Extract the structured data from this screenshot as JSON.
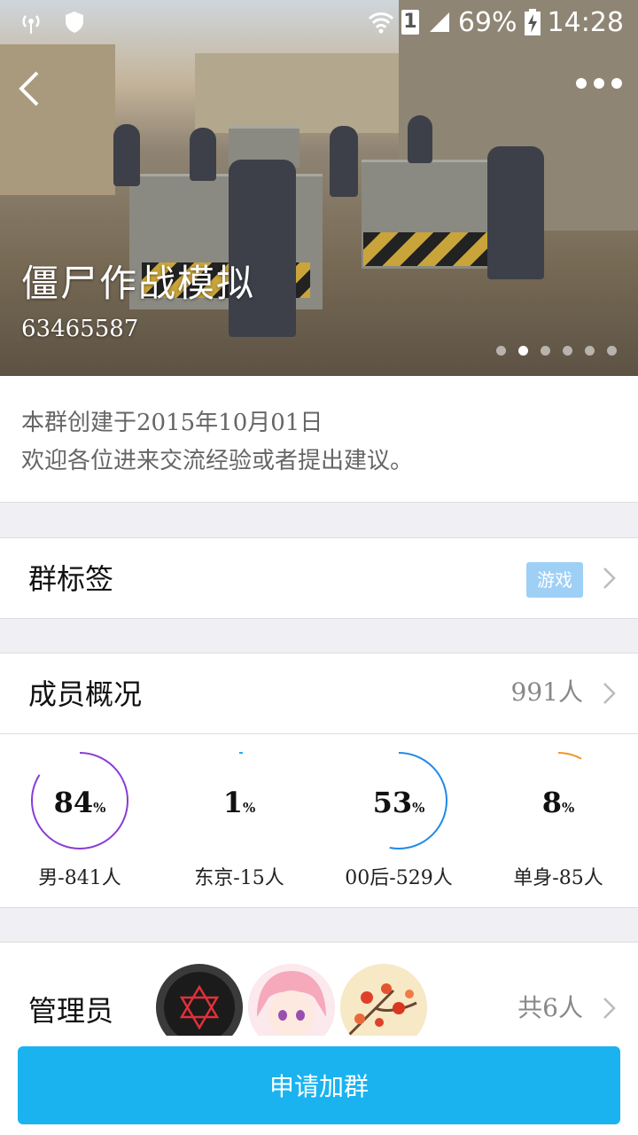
{
  "status_bar": {
    "battery": "69%",
    "time": "14:28",
    "sim": "1"
  },
  "hero": {
    "name": "僵尸作战模拟",
    "id": "63465587",
    "slide_count": 6,
    "active_slide": 2
  },
  "intro": {
    "line1": "本群创建于2015年10月01日",
    "line2": "欢迎各位进来交流经验或者提出建议。"
  },
  "tags_row": {
    "label": "群标签",
    "tag": "游戏"
  },
  "members_row": {
    "label": "成员概况",
    "count": "991人"
  },
  "stats": [
    {
      "value": "84",
      "unit": "%",
      "caption": "男-841人",
      "color": "#8a3cd6"
    },
    {
      "value": "1",
      "unit": "%",
      "caption": "东京-15人",
      "color": "#1ea9ea"
    },
    {
      "value": "53",
      "unit": "%",
      "caption": "00后-529人",
      "color": "#1e8ae8"
    },
    {
      "value": "8",
      "unit": "%",
      "caption": "单身-85人",
      "color": "#f0962a"
    }
  ],
  "admins": {
    "label": "管理员",
    "count": "共6人"
  },
  "join_button": "申请加群"
}
